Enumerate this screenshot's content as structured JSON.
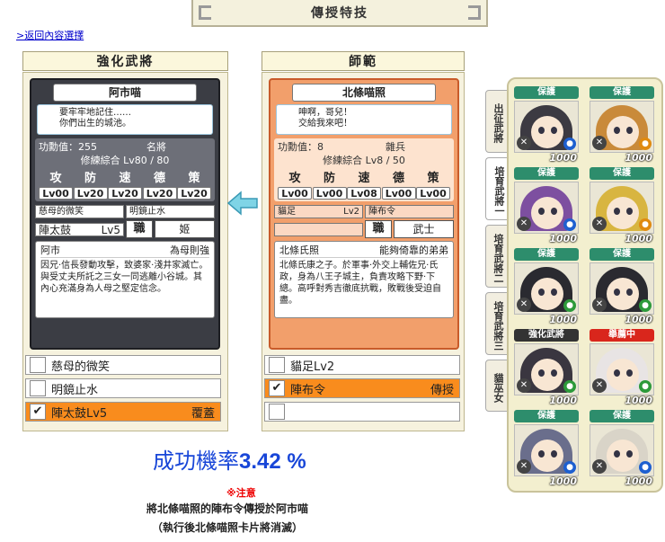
{
  "header": {
    "title": "傳授特技",
    "back_link": ">返回內容選擇"
  },
  "left": {
    "heading": "強化武將",
    "card": {
      "name": "阿市喵",
      "quote": "要牢牢地記住……\n你們出生的城池。",
      "merit_label": "功勳值：",
      "merit_value": "255",
      "rank": "名將",
      "training_label": "修練綜合",
      "training": "Lv80 / 80",
      "attrs": [
        {
          "k": "攻",
          "v": "Lv00"
        },
        {
          "k": "防",
          "v": "Lv20"
        },
        {
          "k": "速",
          "v": "Lv20"
        },
        {
          "k": "德",
          "v": "Lv20"
        },
        {
          "k": "策",
          "v": "Lv20"
        }
      ],
      "skills": [
        {
          "name": "慈母的微笑",
          "lv": ""
        },
        {
          "name": "明鏡止水",
          "lv": ""
        },
        {
          "name": "陣太鼓",
          "lv": "Lv5"
        }
      ],
      "job_label": "職",
      "job": "姬",
      "bio_name": "阿市",
      "bio_tag": "為母則強",
      "bio_text": "因兄·信長發動攻擊，致婆家·淺井家滅亡。與受丈夫所託之三女一同逃離小谷城。其內心充滿身為人母之堅定信念。"
    },
    "slots": [
      {
        "label": "慈母的微笑",
        "checked": "",
        "tail": ""
      },
      {
        "label": "明鏡止水",
        "checked": "",
        "tail": ""
      },
      {
        "label": "陣太鼓Lv5",
        "checked": "✔",
        "tail": "覆蓋"
      }
    ]
  },
  "right": {
    "heading": "師範",
    "card": {
      "name": "北條喵照",
      "quote": "呻啊，哥兒！\n交給我來吧！",
      "merit_label": "功勳值：",
      "merit_value": "8",
      "rank": "雜兵",
      "training_label": "修練綜合",
      "training": "Lv8 / 50",
      "attrs": [
        {
          "k": "攻",
          "v": "Lv00"
        },
        {
          "k": "防",
          "v": "Lv00"
        },
        {
          "k": "速",
          "v": "Lv08"
        },
        {
          "k": "德",
          "v": "Lv00"
        },
        {
          "k": "策",
          "v": "Lv00"
        }
      ],
      "skills": [
        {
          "name": "貓足",
          "lv": "Lv2"
        },
        {
          "name": "陣布令",
          "lv": ""
        }
      ],
      "job_label": "職",
      "job": "武士",
      "bio_name": "北條氏照",
      "bio_tag": "能夠倚靠的弟弟",
      "bio_text": "北條氏康之子。於軍事·外交上輔佐兄·氏政，身為八王子城主，負責攻略下野·下總。高呼對秀吉徹底抗戰，敗戰後受迫自盡。"
    },
    "slots": [
      {
        "label": "貓足Lv2",
        "checked": "",
        "tail": ""
      },
      {
        "label": "陣布令",
        "checked": "✔",
        "tail": "傳授"
      },
      {
        "label": "",
        "checked": "",
        "tail": ""
      }
    ]
  },
  "result": {
    "label": "成功機率",
    "value": "3.42 %",
    "warn_title": "※注意",
    "warn_line1": "將北條喵照的陣布令傳授於阿市喵",
    "warn_line2": "（執行後北條喵照卡片將消滅）"
  },
  "side_tabs": [
    "出征武將",
    "培育武將一",
    "培育武將二",
    "培育武將三",
    "貓巫女"
  ],
  "grid": [
    {
      "label": "保護",
      "value": "1000",
      "hair": "#3c3a42",
      "badge": "#1d5fd0"
    },
    {
      "label": "保護",
      "value": "1000",
      "hair": "#c98a3a",
      "badge": "#e08a10"
    },
    {
      "label": "保護",
      "value": "1000",
      "hair": "#7d4fa0",
      "badge": "#1d5fd0"
    },
    {
      "label": "保護",
      "value": "1000",
      "hair": "#d8b540",
      "badge": "#e08a10"
    },
    {
      "label": "保護",
      "value": "1000",
      "hair": "#2a2a30",
      "badge": "#2c9a3a"
    },
    {
      "label": "保護",
      "value": "1000",
      "hair": "#2a2a30",
      "badge": "#2c9a3a"
    },
    {
      "label": "強化武將",
      "value": "1000",
      "hair": "#3a3640",
      "badge": "#2c9a3a"
    },
    {
      "label": "舉薦中",
      "value": "1000",
      "hair": "#e8e4e4",
      "badge": "#2c9a3a"
    },
    {
      "label": "保護",
      "value": "1000",
      "hair": "#6a6e8c",
      "badge": "#1d5fd0"
    },
    {
      "label": "保護",
      "value": "1000",
      "hair": "#d9d4c8",
      "badge": "#1d5fd0"
    }
  ],
  "colors": {
    "accent_orange": "#f98c1d",
    "rate_blue": "#1846d8",
    "warn_red": "#e00000"
  }
}
